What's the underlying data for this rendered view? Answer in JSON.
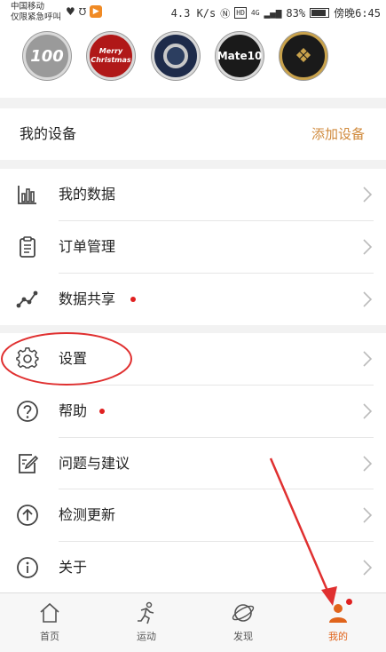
{
  "status_bar": {
    "carrier_line1": "中国移动",
    "carrier_line2": "仅限紧急呼叫",
    "speed": "4.3 K/s",
    "hd": "HD",
    "network": "4G",
    "battery": "83%",
    "time": "傍晚6:45"
  },
  "medals": [
    {
      "text": "100",
      "color": "#9a9a9a"
    },
    {
      "text": "Merry Christmas",
      "color": "#b01818"
    },
    {
      "text": "",
      "color": "#1e2b4a"
    },
    {
      "text": "Mate10",
      "color": "#1a1a1a"
    },
    {
      "text": "",
      "color": "#1a1a1a"
    }
  ],
  "devices": {
    "title": "我的设备",
    "add_label": "添加设备"
  },
  "menu_group1": [
    {
      "label": "我的数据",
      "icon": "bar-chart-icon",
      "dot": false
    },
    {
      "label": "订单管理",
      "icon": "clipboard-icon",
      "dot": false
    },
    {
      "label": "数据共享",
      "icon": "share-graph-icon",
      "dot": true
    }
  ],
  "menu_group2": [
    {
      "label": "设置",
      "icon": "gear-icon",
      "dot": false
    },
    {
      "label": "帮助",
      "icon": "question-icon",
      "dot": true
    },
    {
      "label": "问题与建议",
      "icon": "edit-icon",
      "dot": false
    },
    {
      "label": "检测更新",
      "icon": "upload-icon",
      "dot": false
    },
    {
      "label": "关于",
      "icon": "info-icon",
      "dot": false
    }
  ],
  "tabs": [
    {
      "label": "首页",
      "icon": "home-icon",
      "active": false
    },
    {
      "label": "运动",
      "icon": "running-icon",
      "active": false
    },
    {
      "label": "发现",
      "icon": "planet-icon",
      "active": false
    },
    {
      "label": "我的",
      "icon": "profile-icon",
      "active": true
    }
  ],
  "colors": {
    "accent": "#d08a3c",
    "active_tab": "#e0641c",
    "notification_dot": "#e02020",
    "annotation_red": "#e03030"
  }
}
